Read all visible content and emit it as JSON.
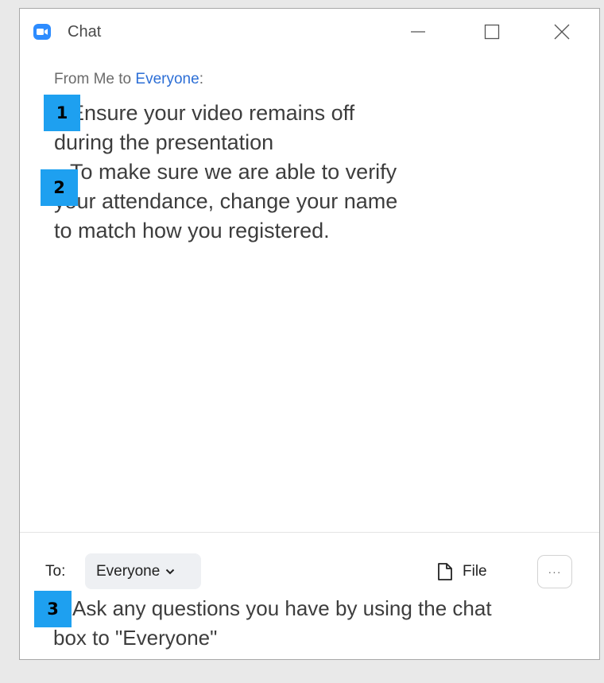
{
  "window": {
    "title": "Chat",
    "icon": "zoom-camera-icon",
    "controls": [
      "minimize-icon",
      "maximize-icon",
      "close-icon"
    ]
  },
  "message": {
    "sender_prefix": "From Me to ",
    "recipient": "Everyone",
    "sender_suffix": ":",
    "body_line1": "Ensure your video remains off",
    "body_line2": "during the presentation",
    "body_line3": "To make sure we are able to verify",
    "body_line4": "your attendance, change your name",
    "body_line5": "to match how you registered."
  },
  "annotations": {
    "marker1": "1",
    "marker2": "2",
    "marker3": "3"
  },
  "compose": {
    "to_label": "To:",
    "recipient_value": "Everyone",
    "file_label": "File",
    "more_label": "···",
    "input_text_line1": "Ask any questions you have by using the chat",
    "input_text_line2": "box to \"Everyone\""
  },
  "colors": {
    "accent": "#2d6fd6",
    "annotation": "#1ea0f0",
    "app_icon": "#2d8cff"
  }
}
